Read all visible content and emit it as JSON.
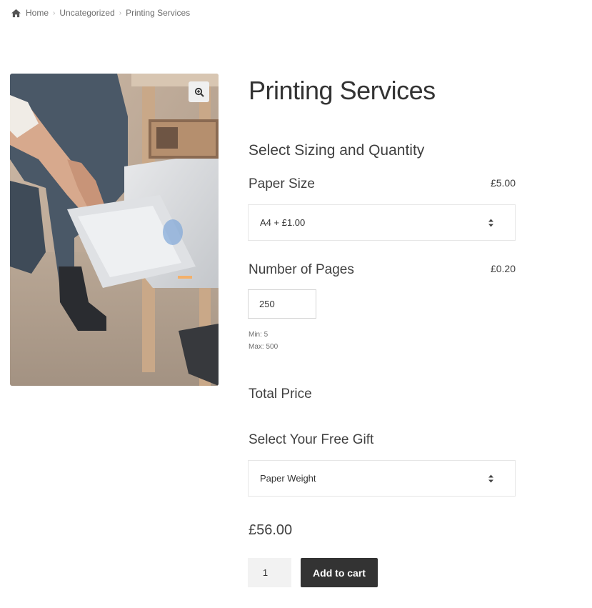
{
  "breadcrumb": {
    "home": "Home",
    "category": "Uncategorized",
    "current": "Printing Services"
  },
  "product": {
    "title": "Printing Services",
    "image_alt": "person loading paper into printer",
    "zoom_icon": "magnify-plus-icon"
  },
  "options": {
    "section_title": "Select Sizing and Quantity",
    "paper_size": {
      "label": "Paper Size",
      "price": "£5.00",
      "selected": "A4 + £1.00"
    },
    "pages": {
      "label": "Number of Pages",
      "price": "£0.20",
      "value": "250",
      "min": "Min: 5",
      "max": "Max: 500"
    },
    "total_label": "Total Price",
    "gift": {
      "label": "Select Your Free Gift",
      "selected": "Paper Weight"
    }
  },
  "cart": {
    "price": "£56.00",
    "quantity": "1",
    "add_label": "Add to cart"
  },
  "colors": {
    "button_bg": "#333333",
    "text": "#404040"
  }
}
